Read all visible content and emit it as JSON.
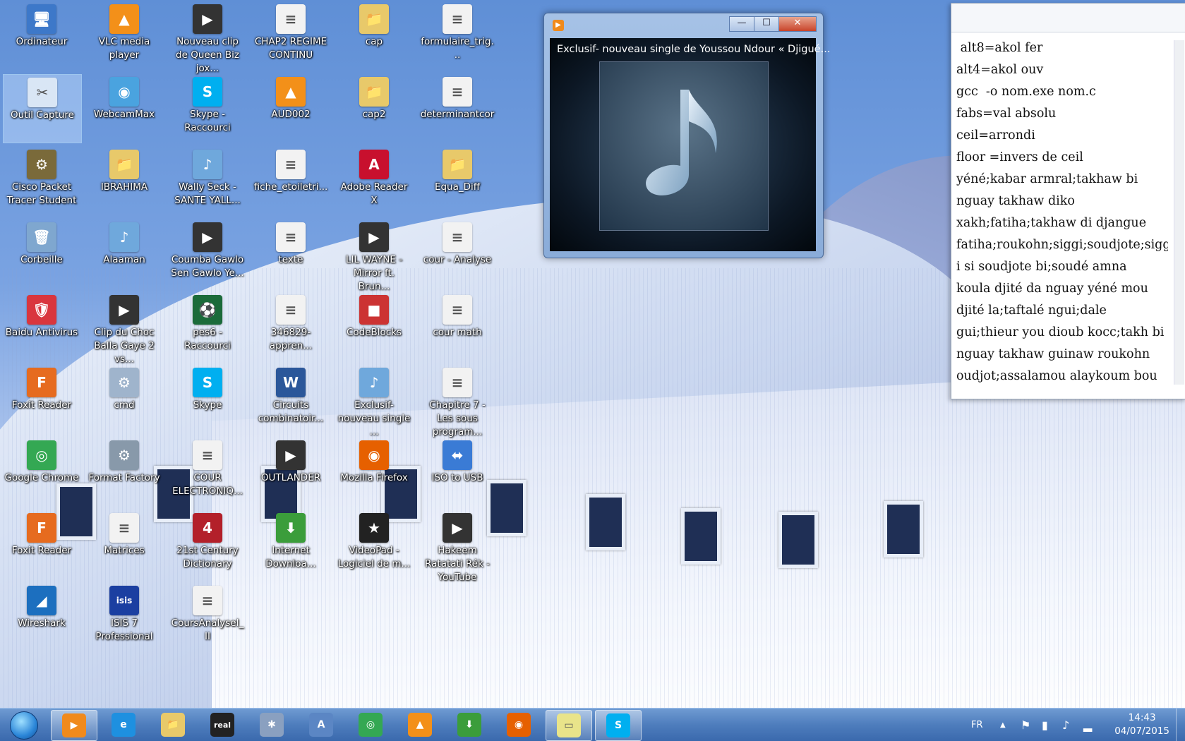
{
  "desktop": {
    "icons": [
      {
        "label": "Ordinateur",
        "glyph": "🖥",
        "color": "#3d78c9"
      },
      {
        "label": "VLC media player",
        "glyph": "▲",
        "color": "#f39019"
      },
      {
        "label": "Nouveau clip de Queen Biz jox...",
        "glyph": "▶",
        "color": "#333333"
      },
      {
        "label": "CHAP2 REGIME CONTINU",
        "glyph": "≡",
        "color": "#f2f2f2"
      },
      {
        "label": "cap",
        "glyph": "📁",
        "color": "#e8c96a"
      },
      {
        "label": "formulaire_trig...",
        "glyph": "≡",
        "color": "#f2f2f2"
      },
      {
        "label": "Outil Capture",
        "glyph": "✂",
        "color": "#d9e6f5"
      },
      {
        "label": "WebcamMax",
        "glyph": "◉",
        "color": "#4aa3df"
      },
      {
        "label": "Skype - Raccourci",
        "glyph": "S",
        "color": "#00aff0"
      },
      {
        "label": "AUD002",
        "glyph": "▲",
        "color": "#f39019"
      },
      {
        "label": "cap2",
        "glyph": "📁",
        "color": "#e8c96a"
      },
      {
        "label": "determinantcor",
        "glyph": "≡",
        "color": "#f2f2f2"
      },
      {
        "label": "Cisco Packet Tracer Student",
        "glyph": "⚙",
        "color": "#7a6a3a"
      },
      {
        "label": "IBRAHIMA",
        "glyph": "📁",
        "color": "#e8c96a"
      },
      {
        "label": "Wally Seck - SANTE YALL...",
        "glyph": "♪",
        "color": "#6fa8dc"
      },
      {
        "label": "fiche_etoiletri...",
        "glyph": "≡",
        "color": "#f2f2f2"
      },
      {
        "label": "Adobe Reader X",
        "glyph": "A",
        "color": "#c8102e"
      },
      {
        "label": "Equa_Diff",
        "glyph": "📁",
        "color": "#e8c96a"
      },
      {
        "label": "Corbeille",
        "glyph": "🗑",
        "color": "#7fa7cf"
      },
      {
        "label": "Alaaman",
        "glyph": "♪",
        "color": "#6fa8dc"
      },
      {
        "label": "Coumba Gawlo Sen Gawlo Ye...",
        "glyph": "▶",
        "color": "#333333"
      },
      {
        "label": "texte",
        "glyph": "≡",
        "color": "#f2f2f2"
      },
      {
        "label": "LIL WAYNE - Mirror ft. Brun...",
        "glyph": "▶",
        "color": "#333333"
      },
      {
        "label": "cour - Analyse",
        "glyph": "≡",
        "color": "#f2f2f2"
      },
      {
        "label": "Baidu Antivirus",
        "glyph": "🛡",
        "color": "#d9363e"
      },
      {
        "label": "Clip du Choc Balla Gaye 2 vs...",
        "glyph": "▶",
        "color": "#333333"
      },
      {
        "label": "pes6 - Raccourci",
        "glyph": "⚽",
        "color": "#1b6b3a"
      },
      {
        "label": "346829-appren...",
        "glyph": "≡",
        "color": "#f2f2f2"
      },
      {
        "label": "CodeBlocks",
        "glyph": "■",
        "color": "#cc3333"
      },
      {
        "label": "cour math",
        "glyph": "≡",
        "color": "#f2f2f2"
      },
      {
        "label": "Foxit Reader",
        "glyph": "F",
        "color": "#e66b1f"
      },
      {
        "label": "cmd",
        "glyph": "⚙",
        "color": "#9fb4cc"
      },
      {
        "label": "Skype",
        "glyph": "S",
        "color": "#00aff0"
      },
      {
        "label": "Circuits combinatoir...",
        "glyph": "W",
        "color": "#2b579a"
      },
      {
        "label": "Exclusif- nouveau single ...",
        "glyph": "♪",
        "color": "#6fa8dc"
      },
      {
        "label": "Chapitre 7 - Les sous program...",
        "glyph": "≡",
        "color": "#f2f2f2"
      },
      {
        "label": "Google Chrome",
        "glyph": "◎",
        "color": "#34a853"
      },
      {
        "label": "Format Factory",
        "glyph": "⚙",
        "color": "#8899aa"
      },
      {
        "label": "COUR ELECTRONIQ...",
        "glyph": "≡",
        "color": "#f2f2f2"
      },
      {
        "label": "OUTLANDER",
        "glyph": "▶",
        "color": "#333333"
      },
      {
        "label": "Mozilla Firefox",
        "glyph": "◉",
        "color": "#e66000"
      },
      {
        "label": "ISO to USB",
        "glyph": "⬌",
        "color": "#3a7bd5"
      },
      {
        "label": "Foxit Reader",
        "glyph": "F",
        "color": "#e66b1f"
      },
      {
        "label": "Matrices",
        "glyph": "≡",
        "color": "#f2f2f2"
      },
      {
        "label": "21st Century Dictionary",
        "glyph": "4",
        "color": "#b3202a"
      },
      {
        "label": "Internet Downloa...",
        "glyph": "⬇",
        "color": "#3b9d3b"
      },
      {
        "label": "VideoPad - Logiciel de m...",
        "glyph": "★",
        "color": "#222222"
      },
      {
        "label": "Hakeem Ratatati Rék - YouTube",
        "glyph": "▶",
        "color": "#333333"
      },
      {
        "label": "Wireshark",
        "glyph": "◢",
        "color": "#1c6fbf"
      },
      {
        "label": "ISIS 7 Professional",
        "glyph": "isis",
        "color": "#1b3fa1"
      },
      {
        "label": "CoursAnalyseI_II",
        "glyph": "≡",
        "color": "#f2f2f2"
      }
    ]
  },
  "player": {
    "title": "Exclusif- nouveau single de Youssou Ndour « Djigué...",
    "minimize": "—",
    "maximize": "☐",
    "close": "✕"
  },
  "notes": {
    "lines": [
      " alt8=akol fer",
      "alt4=akol ouv",
      "gcc  -o nom.exe nom.c",
      "fabs=val absolu",
      "ceil=arrondi",
      "floor =invers de ceil",
      "yéné;kabar armral;takhaw bi",
      "nguay takhaw diko",
      "xakh;fatiha;takhaw di djangue",
      "fatiha;roukohn;siggi;soudjote;sigg",
      "i si soudjote bi;soudé amna",
      "koula djité da nguay yéné mou",
      "djité la;taftalé ngui;dale",
      "gui;thieur you dioub kocc;takh bi",
      "nguay takhaw guinaw roukohn",
      "oudjot;assalamou alaykoum bou"
    ]
  },
  "taskbar": {
    "apps": [
      {
        "name": "media-player",
        "glyph": "▶",
        "color": "#f08a1c",
        "active": true
      },
      {
        "name": "internet-explorer",
        "glyph": "e",
        "color": "#1e90e0",
        "active": false
      },
      {
        "name": "file-explorer",
        "glyph": "📁",
        "color": "#e8c96a",
        "active": false
      },
      {
        "name": "realplayer",
        "glyph": "real",
        "color": "#222222",
        "active": false
      },
      {
        "name": "unknown-app",
        "glyph": "✱",
        "color": "#8aa0c0",
        "active": false
      },
      {
        "name": "document-app",
        "glyph": "A",
        "color": "#5b86c4",
        "active": false
      },
      {
        "name": "chrome",
        "glyph": "◎",
        "color": "#34a853",
        "active": false
      },
      {
        "name": "vlc",
        "glyph": "▲",
        "color": "#f39019",
        "active": false
      },
      {
        "name": "internet-download-manager",
        "glyph": "⬇",
        "color": "#3b9d3b",
        "active": false
      },
      {
        "name": "firefox",
        "glyph": "◉",
        "color": "#e66000",
        "active": false
      },
      {
        "name": "sticky-notes",
        "glyph": "▭",
        "color": "#e9e48a",
        "active": true
      },
      {
        "name": "skype",
        "glyph": "S",
        "color": "#00aff0",
        "active": true
      }
    ],
    "language": "FR",
    "tray_arrow": "▲",
    "time": "14:43",
    "date": "04/07/2015"
  }
}
